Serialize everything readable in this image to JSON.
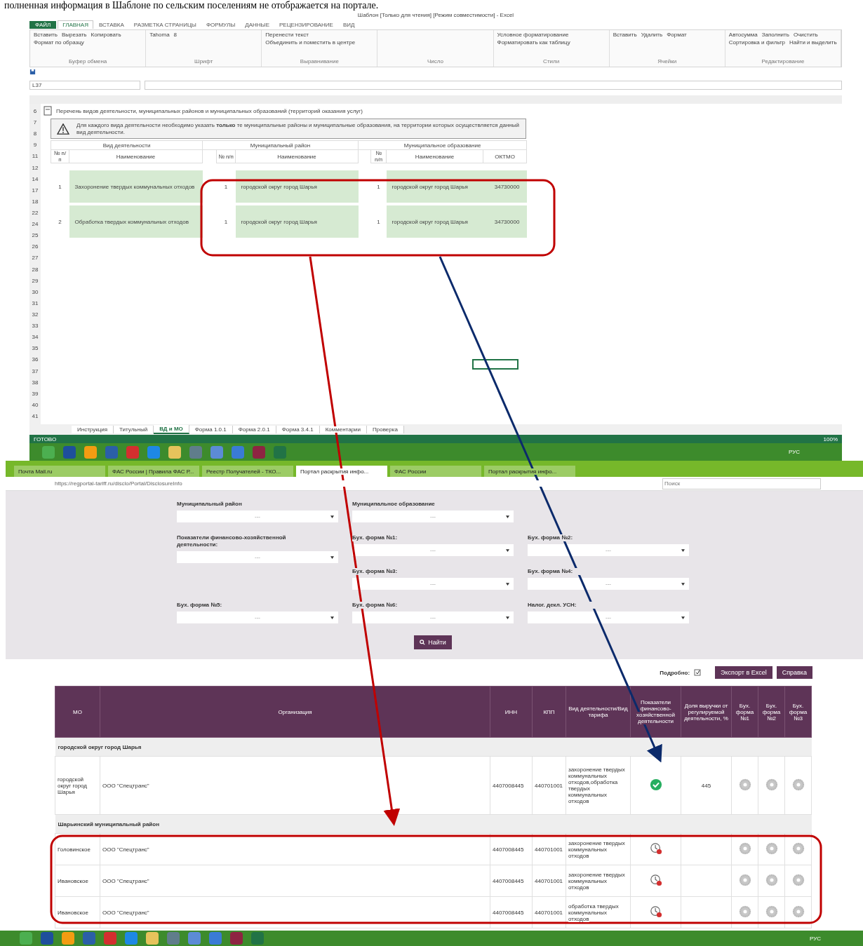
{
  "caption": "полненная информация в Шаблоне по сельским поселениям не отображается на портале.",
  "excel": {
    "title": "Шаблон [Только для чтения] [Режим совместимости] - Excel",
    "file_tab": "ФАЙЛ",
    "tabs": [
      {
        "label": "ГЛАВНАЯ",
        "selected": true
      },
      {
        "label": "ВСТАВКА",
        "selected": false
      },
      {
        "label": "РАЗМЕТКА СТРАНИЦЫ",
        "selected": false
      },
      {
        "label": "ФОРМУЛЫ",
        "selected": false
      },
      {
        "label": "ДАННЫЕ",
        "selected": false
      },
      {
        "label": "РЕЦЕНЗИРОВАНИЕ",
        "selected": false
      },
      {
        "label": "ВИД",
        "selected": false
      }
    ],
    "ribbon_groups": [
      {
        "name": "Буфер обмена",
        "buttons": [
          "Вставить",
          "Вырезать",
          "Копировать",
          "Формат по образцу"
        ]
      },
      {
        "name": "Шрифт",
        "buttons": [
          "Tahoma",
          "8"
        ]
      },
      {
        "name": "Выравнивание",
        "buttons": [
          "Перенести текст",
          "Объединить и поместить в центре"
        ]
      },
      {
        "name": "Число"
      },
      {
        "name": "Стили",
        "buttons": [
          "Условное форматирование",
          "Форматировать как таблицу"
        ]
      },
      {
        "name": "Ячейки",
        "buttons": [
          "Вставить",
          "Удалить",
          "Формат"
        ]
      },
      {
        "name": "Редактирование",
        "buttons": [
          "Автосумма",
          "Заполнить",
          "Очистить",
          "Сортировка и фильтр",
          "Найти и выделить"
        ]
      }
    ],
    "name_box": "L37",
    "sheet_heading": "Перечень видов деятельности, муниципальных районов и муниципальных образований (территорий оказания услуг)",
    "warning": "Для каждого вида деятельности необходимо указать **только** те муниципальные районы и муниципальные образования, на территории которых осуществляется данный вид деятельности.",
    "group_headers": [
      "Вид деятельности",
      "Муниципальный район",
      "Муниципальное образование"
    ],
    "columns": [
      "№ п/п",
      "Наименование",
      "№ п/п",
      "Наименование",
      "№ п/п",
      "Наименование",
      "ОКТМО"
    ],
    "rows": [
      {
        "num": "1",
        "activity": "Захоронение твердых коммунальных отходов",
        "district_num": "1",
        "district": "городской округ город Шарья",
        "mo_num": "1",
        "mo": "городской округ город Шарья",
        "oktmo": "34730000"
      },
      {
        "num": "2",
        "activity": "Обработка твердых коммунальных отходов",
        "district_num": "1",
        "district": "городской округ город Шарья",
        "mo_num": "1",
        "mo": "городской округ город Шарья",
        "oktmo": "34730000"
      }
    ],
    "row_numbers": [
      "6",
      "7",
      "8",
      "9",
      "11",
      "12",
      "14",
      "17",
      "18",
      "22",
      "24",
      "25",
      "26",
      "27",
      "28",
      "29",
      "30",
      "31",
      "32",
      "33",
      "34",
      "35",
      "36",
      "37",
      "38",
      "39",
      "40",
      "41"
    ],
    "sheet_tabs": [
      {
        "label": "Инструкция",
        "selected": false
      },
      {
        "label": "Титульный",
        "selected": false
      },
      {
        "label": "ВД и МО",
        "selected": true
      },
      {
        "label": "Форма 1.0.1",
        "selected": false
      },
      {
        "label": "Форма 2.0.1",
        "selected": false
      },
      {
        "label": "Форма 3.4.1",
        "selected": false
      },
      {
        "label": "Комментарии",
        "selected": false
      },
      {
        "label": "Проверка",
        "selected": false
      }
    ],
    "status": "ГОТОВО",
    "zoom": "100%",
    "taskbar_lang": "РУС"
  },
  "browser": {
    "tabs": [
      {
        "label": "Почта Mail.ru",
        "selected": false
      },
      {
        "label": "ФАС России | Правила ФАС Р...",
        "selected": false
      },
      {
        "label": "Реестр Получателей - ТКО...",
        "selected": false
      },
      {
        "label": "Портал раскрытия инфо...",
        "selected": true
      },
      {
        "label": "ФАС России",
        "selected": false
      },
      {
        "label": "Портал раскрытия инфо...",
        "selected": false
      }
    ],
    "taskbar_lang": "РУС",
    "url": "https://regportal-tariff.ru/disclo/Portal/DisclosureInfo",
    "search_placeholder": "Поиск",
    "filters": [
      {
        "label": "Муниципальный район",
        "value": "---"
      },
      {
        "label": "Муниципальное образование",
        "value": "---"
      },
      {
        "label": "Показатели финансово-хозяйственной деятельности:",
        "value": "---"
      },
      {
        "label": "Бух. форма №1:",
        "value": "---"
      },
      {
        "label": "Бух. форма №2:",
        "value": "---"
      },
      {
        "label": "Бух. форма №3:",
        "value": "---"
      },
      {
        "label": "Бух. форма №4:",
        "value": "---"
      },
      {
        "label": "Бух. форма №5:",
        "value": "---"
      },
      {
        "label": "Бух. форма №6:",
        "value": "---"
      },
      {
        "label": "Налог. декл. УСН:",
        "value": "---"
      }
    ],
    "find_button": "Найти",
    "detail_label": "Подробно:",
    "export_button": "Экспорт в Excel",
    "help_button": "Справка",
    "columns": [
      "МО",
      "Организация",
      "ИНН",
      "КПП",
      "Вид деятельности/Вид тарифа",
      "Показатели финансово-хозяйственной деятельности",
      "Доля выручки от регулируемой деятельности, %",
      "Бух. форма №1",
      "Бух. форма №2",
      "Бух. форма №3"
    ],
    "groups": [
      {
        "name": "городской округ город Шарья",
        "rows": [
          {
            "mo": "городской округ город Шарья",
            "org": "ООО \"Спецтранс\"",
            "inn": "4407008445",
            "kpp": "440701001",
            "activity": "захоронение твердых коммунальных отходов,обработка твердых коммунальных отходов",
            "submitted": true,
            "share": "445"
          }
        ]
      },
      {
        "name": "Шарьинский муниципальный район",
        "rows": [
          {
            "mo": "Головинское",
            "org": "ООО \"Спецтранс\"",
            "inn": "4407008445",
            "kpp": "440701001",
            "activity": "захоронение твердых коммунальных отходов",
            "submitted": false
          },
          {
            "mo": "Ивановское",
            "org": "ООО \"Спецтранс\"",
            "inn": "4407008445",
            "kpp": "440701001",
            "activity": "захоронение твердых коммунальных отходов",
            "submitted": false
          },
          {
            "mo": "Ивановское",
            "org": "ООО \"Спецтранс\"",
            "inn": "4407008445",
            "kpp": "440701001",
            "activity": "обработка твердых коммунальных отходов",
            "submitted": false
          }
        ]
      }
    ]
  }
}
